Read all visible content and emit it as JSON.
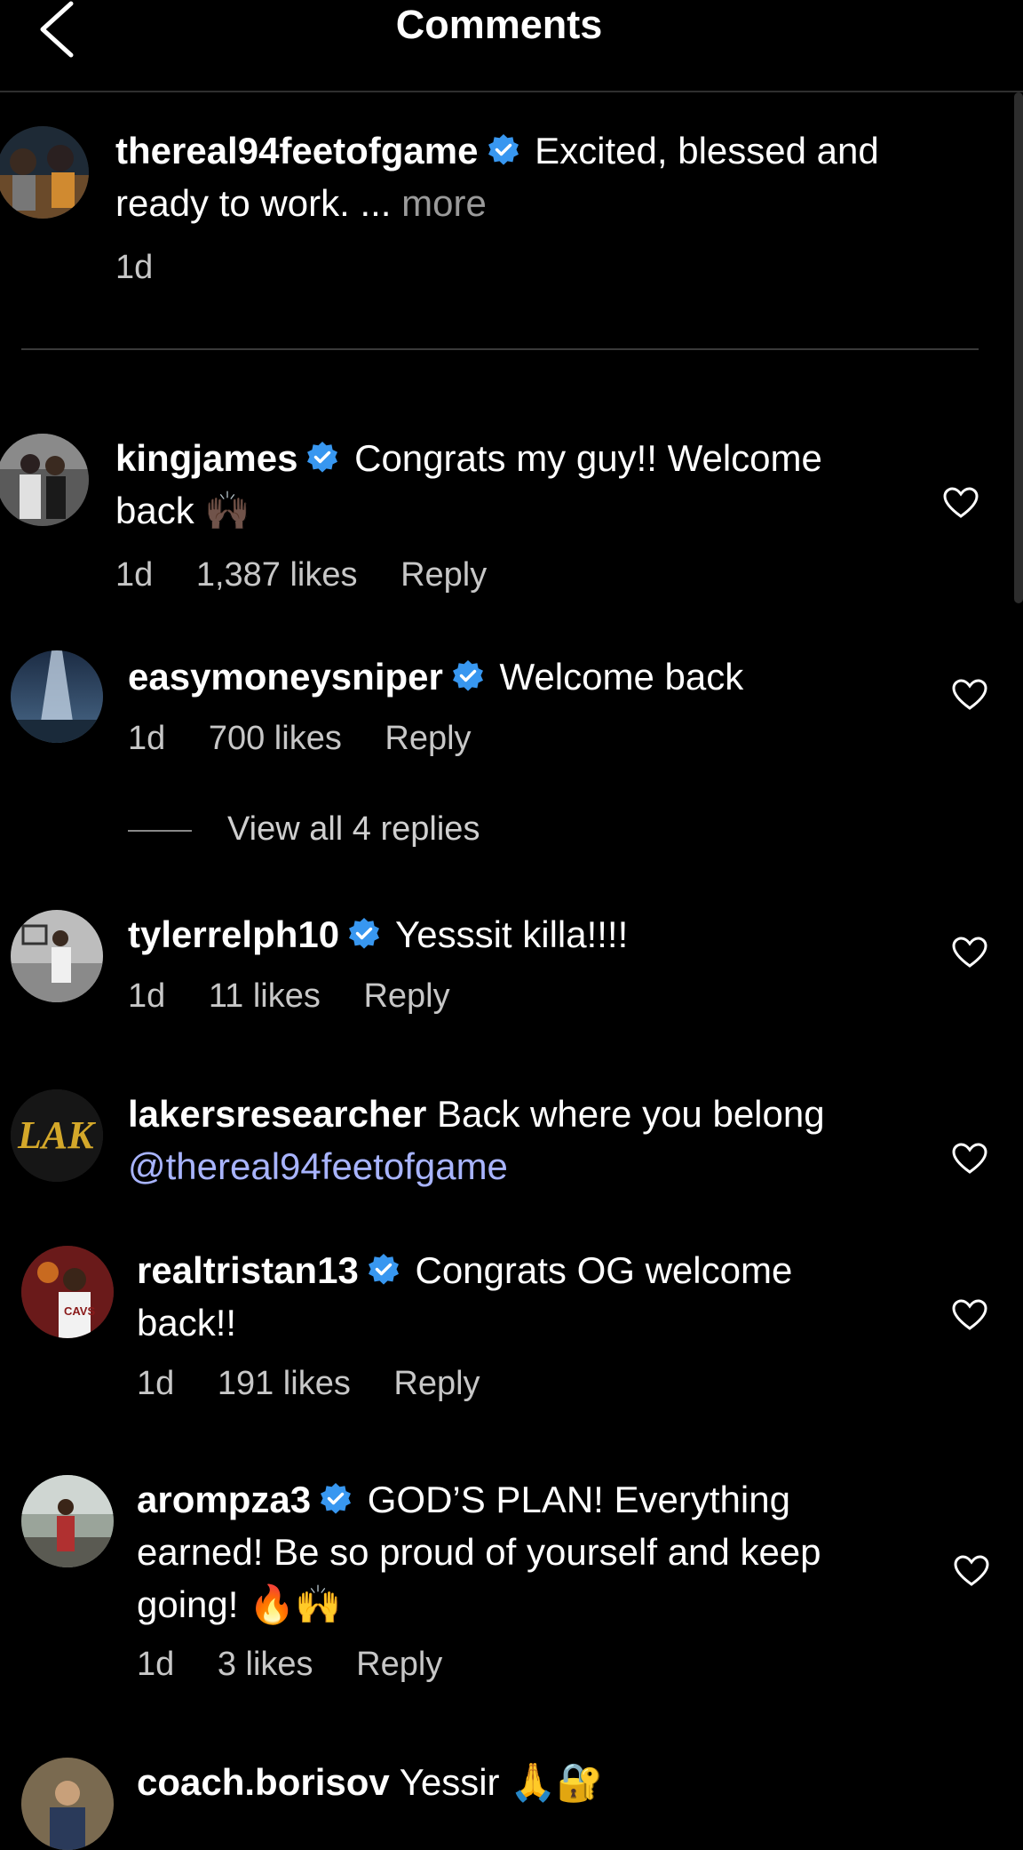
{
  "header": {
    "title": "Comments",
    "back_icon": "chevron-left-icon"
  },
  "post": {
    "username": "thereal94feetofgame",
    "verified": true,
    "caption_line1": "Excited, blessed and",
    "caption_line2": "ready to work. ...",
    "more_label": "more",
    "time": "1d"
  },
  "comments": [
    {
      "username": "kingjames",
      "verified": true,
      "line1": "Congrats my guy!! Welcome",
      "line2": "back",
      "emoji": "🙌🏿",
      "time": "1d",
      "likes": "1,387 likes",
      "reply": "Reply"
    },
    {
      "username": "easymoneysniper",
      "verified": true,
      "line1": "Welcome back",
      "time": "1d",
      "likes": "700 likes",
      "reply": "Reply"
    },
    {
      "username": "tylerrelph10",
      "verified": true,
      "line1": "Yesssit killa!!!!",
      "time": "1d",
      "likes": "11 likes",
      "reply": "Reply"
    },
    {
      "username": "lakersresearcher",
      "verified": false,
      "line1": "Back where you belong",
      "mention": "@thereal94feetofgame"
    },
    {
      "username": "realtristan13",
      "verified": true,
      "line1": "Congrats OG welcome",
      "line2": "back!!",
      "time": "1d",
      "likes": "191 likes",
      "reply": "Reply"
    },
    {
      "username": "arompza3",
      "verified": true,
      "line1": "GOD’S PLAN! Everything",
      "line2": "earned! Be so proud of yourself and keep",
      "line3": "going!",
      "emoji": "🔥🙌",
      "time": "1d",
      "likes": "3 likes",
      "reply": "Reply"
    },
    {
      "username": "coach.borisov",
      "verified": false,
      "line1": "Yessir",
      "emoji": "🙏🔐"
    }
  ],
  "view_replies": "View all 4 replies",
  "colors": {
    "background": "#000000",
    "verified": "#3897f0",
    "mention": "#a8b4ff",
    "muted": "#c7c7c7"
  }
}
